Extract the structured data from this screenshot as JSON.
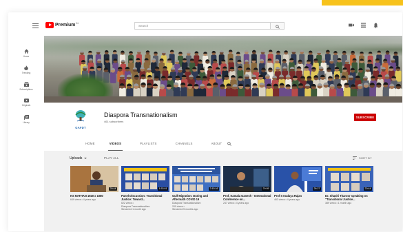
{
  "app": {
    "logo_text": "Premium",
    "logo_sup": "IN"
  },
  "search": {
    "placeholder": "Search"
  },
  "guide": {
    "items": [
      {
        "label": "Home",
        "icon": "home-icon"
      },
      {
        "label": "Trending",
        "icon": "trending-icon"
      },
      {
        "label": "Subscriptions",
        "icon": "subscriptions-icon"
      },
      {
        "label": "Originals",
        "icon": "originals-icon"
      },
      {
        "label": "Library",
        "icon": "library-icon"
      }
    ]
  },
  "channel": {
    "name": "Diaspora Transnationalism",
    "subscribers": "461 subscribers",
    "avatar_text": "GAFDT",
    "subscribe_label": "SUBSCRIBE",
    "tabs": [
      "HOME",
      "VIDEOS",
      "PLAYLISTS",
      "CHANNELS",
      "ABOUT"
    ],
    "active_tab": "VIDEOS"
  },
  "videos_section": {
    "uploads_label": "Uploads",
    "play_all_label": "PLAY ALL",
    "sort_label": "SORT BY"
  },
  "videos": [
    {
      "title": "KS NATHAN 1920 x 1080",
      "meta1": "649 views • 4 years ago",
      "meta2": "",
      "meta3": "",
      "duration": "20:44"
    },
    {
      "title": "Panel Discussion: Transitional Justice: Toward...",
      "meta1": "622 views •",
      "meta2": "Diaspora Transnationalism",
      "meta3": "Streamed 1 month ago",
      "duration": "1:53:01"
    },
    {
      "title": "Gulf Migration: During and Aftermath COVID 19",
      "meta1": "Diaspora Transnationalism",
      "meta2": "200 views •",
      "meta3": "Streamed 5 months ago",
      "duration": "2:15:16"
    },
    {
      "title": "Prof. Kamala Ganesh - International Conference on...",
      "meta1": "247 views • 4 years ago",
      "meta2": "",
      "meta3": "",
      "duration": "20:05"
    },
    {
      "title": "Prof S Irudaya Rajan",
      "meta1": "463 views • 4 years ago",
      "meta2": "",
      "meta3": "",
      "duration": "26:27"
    },
    {
      "title": "Dr. Shashi Tharoor speaking on \"Transitional Justice...",
      "meta1": "389 views • 1 month ago",
      "meta2": "",
      "meta3": "",
      "duration": "20:44"
    }
  ],
  "colors": {
    "brand_red": "#cc0000",
    "logo_red": "#ff0000",
    "accent_yellow": "#f7c21b"
  }
}
